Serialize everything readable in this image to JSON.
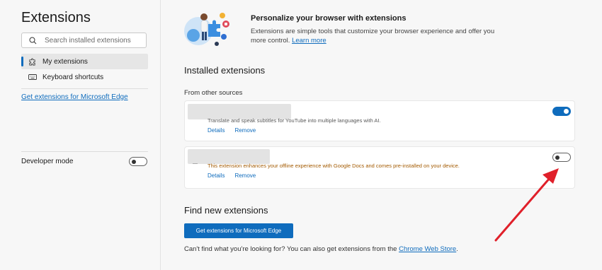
{
  "sidebar": {
    "title": "Extensions",
    "search": {
      "placeholder": "Search installed extensions",
      "value": ""
    },
    "items": [
      {
        "label": "My extensions",
        "icon": "puzzle-icon",
        "active": true
      },
      {
        "label": "Keyboard shortcuts",
        "icon": "keyboard-icon",
        "active": false
      }
    ],
    "store_link": "Get extensions for Microsoft Edge",
    "developer_mode": {
      "label": "Developer mode",
      "enabled": false
    }
  },
  "hero": {
    "title": "Personalize your browser with extensions",
    "description": "Extensions are simple tools that customize your browser experience and offer you more control.",
    "learn_more": "Learn more"
  },
  "installed": {
    "title": "Installed extensions",
    "source_label": "From other sources",
    "extensions": [
      {
        "description": "Translate and speak subtitles for YouTube into multiple languages with AI.",
        "details_label": "Details",
        "remove_label": "Remove",
        "enabled": true
      },
      {
        "description": "This extension enhances your offline experience with Google Docs and comes pre-installed on your device.",
        "details_label": "Details",
        "remove_label": "Remove",
        "enabled": false
      }
    ]
  },
  "find_new": {
    "title": "Find new extensions",
    "button_label": "Get extensions for Microsoft Edge",
    "footer_text": "Can't find what you're looking for? You can also get extensions from the",
    "footer_link": "Chrome Web Store",
    "footer_end": "."
  },
  "colors": {
    "accent": "#0f6cbd",
    "warning_text": "#a35a00",
    "normal_text": "#5a5a5a",
    "annotation_arrow": "#e0202a"
  }
}
